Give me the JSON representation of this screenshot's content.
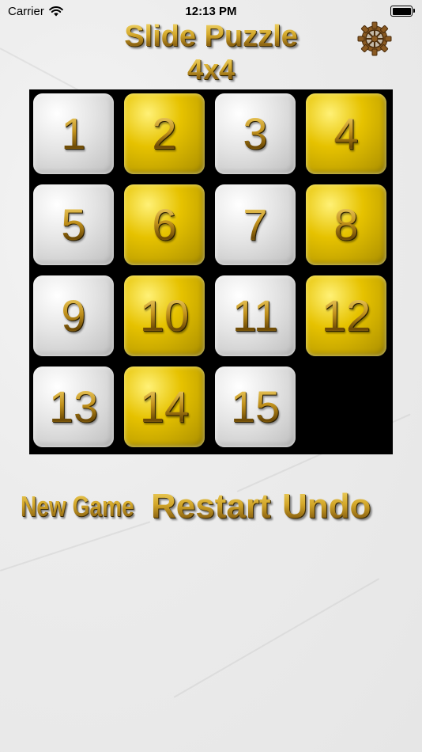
{
  "status_bar": {
    "carrier": "Carrier",
    "time": "12:13 PM"
  },
  "header": {
    "title": "Slide Puzzle",
    "subtitle": "4x4",
    "settings_icon": "gear-icon"
  },
  "board": {
    "tiles": [
      {
        "label": "1",
        "style": "silver"
      },
      {
        "label": "2",
        "style": "gold"
      },
      {
        "label": "3",
        "style": "silver"
      },
      {
        "label": "4",
        "style": "gold"
      },
      {
        "label": "5",
        "style": "silver"
      },
      {
        "label": "6",
        "style": "gold"
      },
      {
        "label": "7",
        "style": "silver"
      },
      {
        "label": "8",
        "style": "gold"
      },
      {
        "label": "9",
        "style": "silver"
      },
      {
        "label": "10",
        "style": "gold"
      },
      {
        "label": "11",
        "style": "silver"
      },
      {
        "label": "12",
        "style": "gold"
      },
      {
        "label": "13",
        "style": "silver"
      },
      {
        "label": "14",
        "style": "gold"
      },
      {
        "label": "15",
        "style": "silver"
      }
    ]
  },
  "controls": {
    "new_game": "New Game",
    "restart": "Restart",
    "undo": "Undo"
  },
  "colors": {
    "board_bg": "#000000",
    "gold_text": "#c9a227",
    "gold_tile": "#e6c200",
    "silver_tile": "#e4e4e4"
  }
}
